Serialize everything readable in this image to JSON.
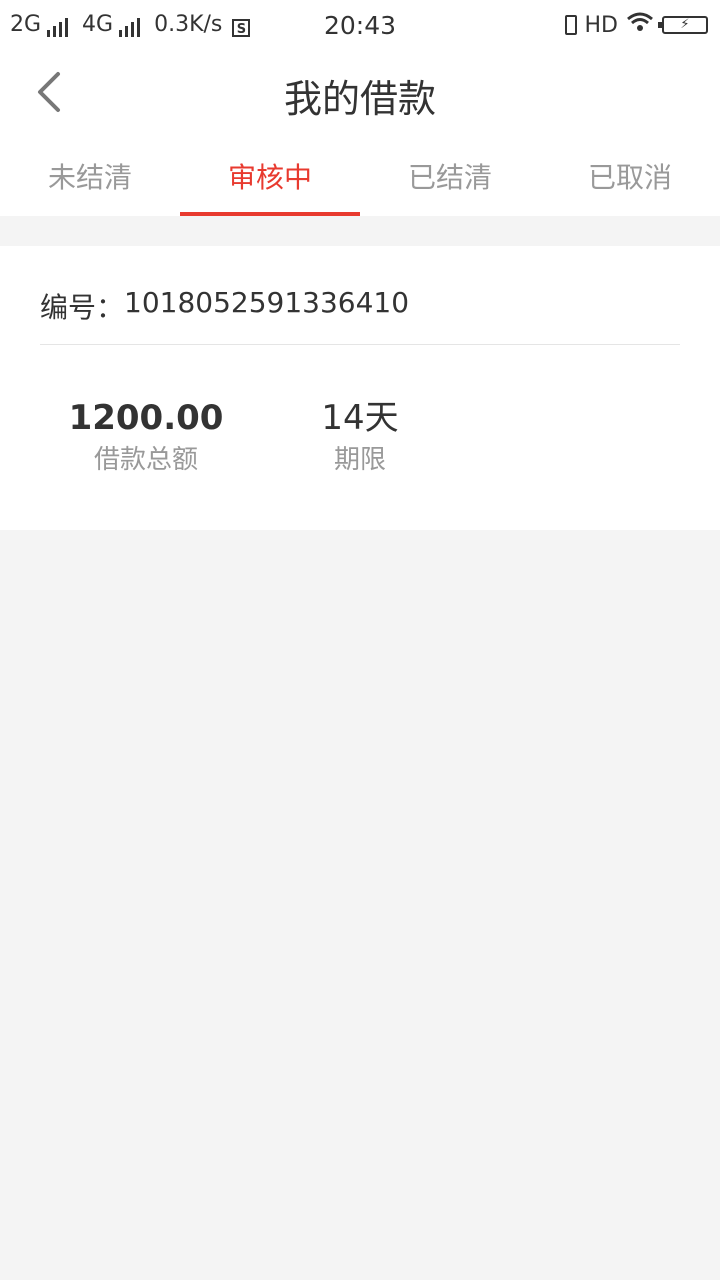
{
  "status_bar": {
    "signal1": "2G",
    "signal2": "4G",
    "speed": "0.3K/s",
    "sim_icon_text": "S",
    "time": "20:43",
    "hd": "HD"
  },
  "nav": {
    "title": "我的借款"
  },
  "tabs": [
    {
      "label": "未结清",
      "active": false
    },
    {
      "label": "审核中",
      "active": true
    },
    {
      "label": "已结清",
      "active": false
    },
    {
      "label": "已取消",
      "active": false
    }
  ],
  "loan": {
    "number_label": "编号：",
    "number": "1018052591336410",
    "amount": "1200.00",
    "amount_label": "借款总额",
    "term": "14天",
    "term_label": "期限"
  },
  "colors": {
    "accent": "#e83a2f",
    "background": "#f4f4f4"
  }
}
